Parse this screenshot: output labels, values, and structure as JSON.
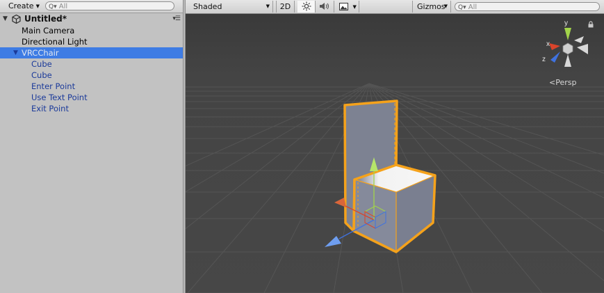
{
  "hierarchy": {
    "create_label": "Create",
    "search_placeholder": "All",
    "scene_name": "Untitled*",
    "items": [
      {
        "label": "Main Camera"
      },
      {
        "label": "Directional Light"
      },
      {
        "label": "VRCChair"
      },
      {
        "label": "Cube"
      },
      {
        "label": "Cube"
      },
      {
        "label": "Enter Point"
      },
      {
        "label": "Use Text Point"
      },
      {
        "label": "Exit Point"
      }
    ]
  },
  "scene_toolbar": {
    "shading_mode": "Shaded",
    "mode_2d_label": "2D",
    "gizmos_label": "Gizmos",
    "search_placeholder": "All"
  },
  "viewport": {
    "projection_label": "Persp",
    "gizmo_axes": {
      "x": "x",
      "y": "y",
      "z": "z"
    },
    "colors": {
      "selection_outline": "#f5a21b",
      "axis_x": "#d9442b",
      "axis_y": "#a2d44a",
      "axis_z": "#3f72e0",
      "hierarchy_selection": "#3e7ce4"
    }
  }
}
